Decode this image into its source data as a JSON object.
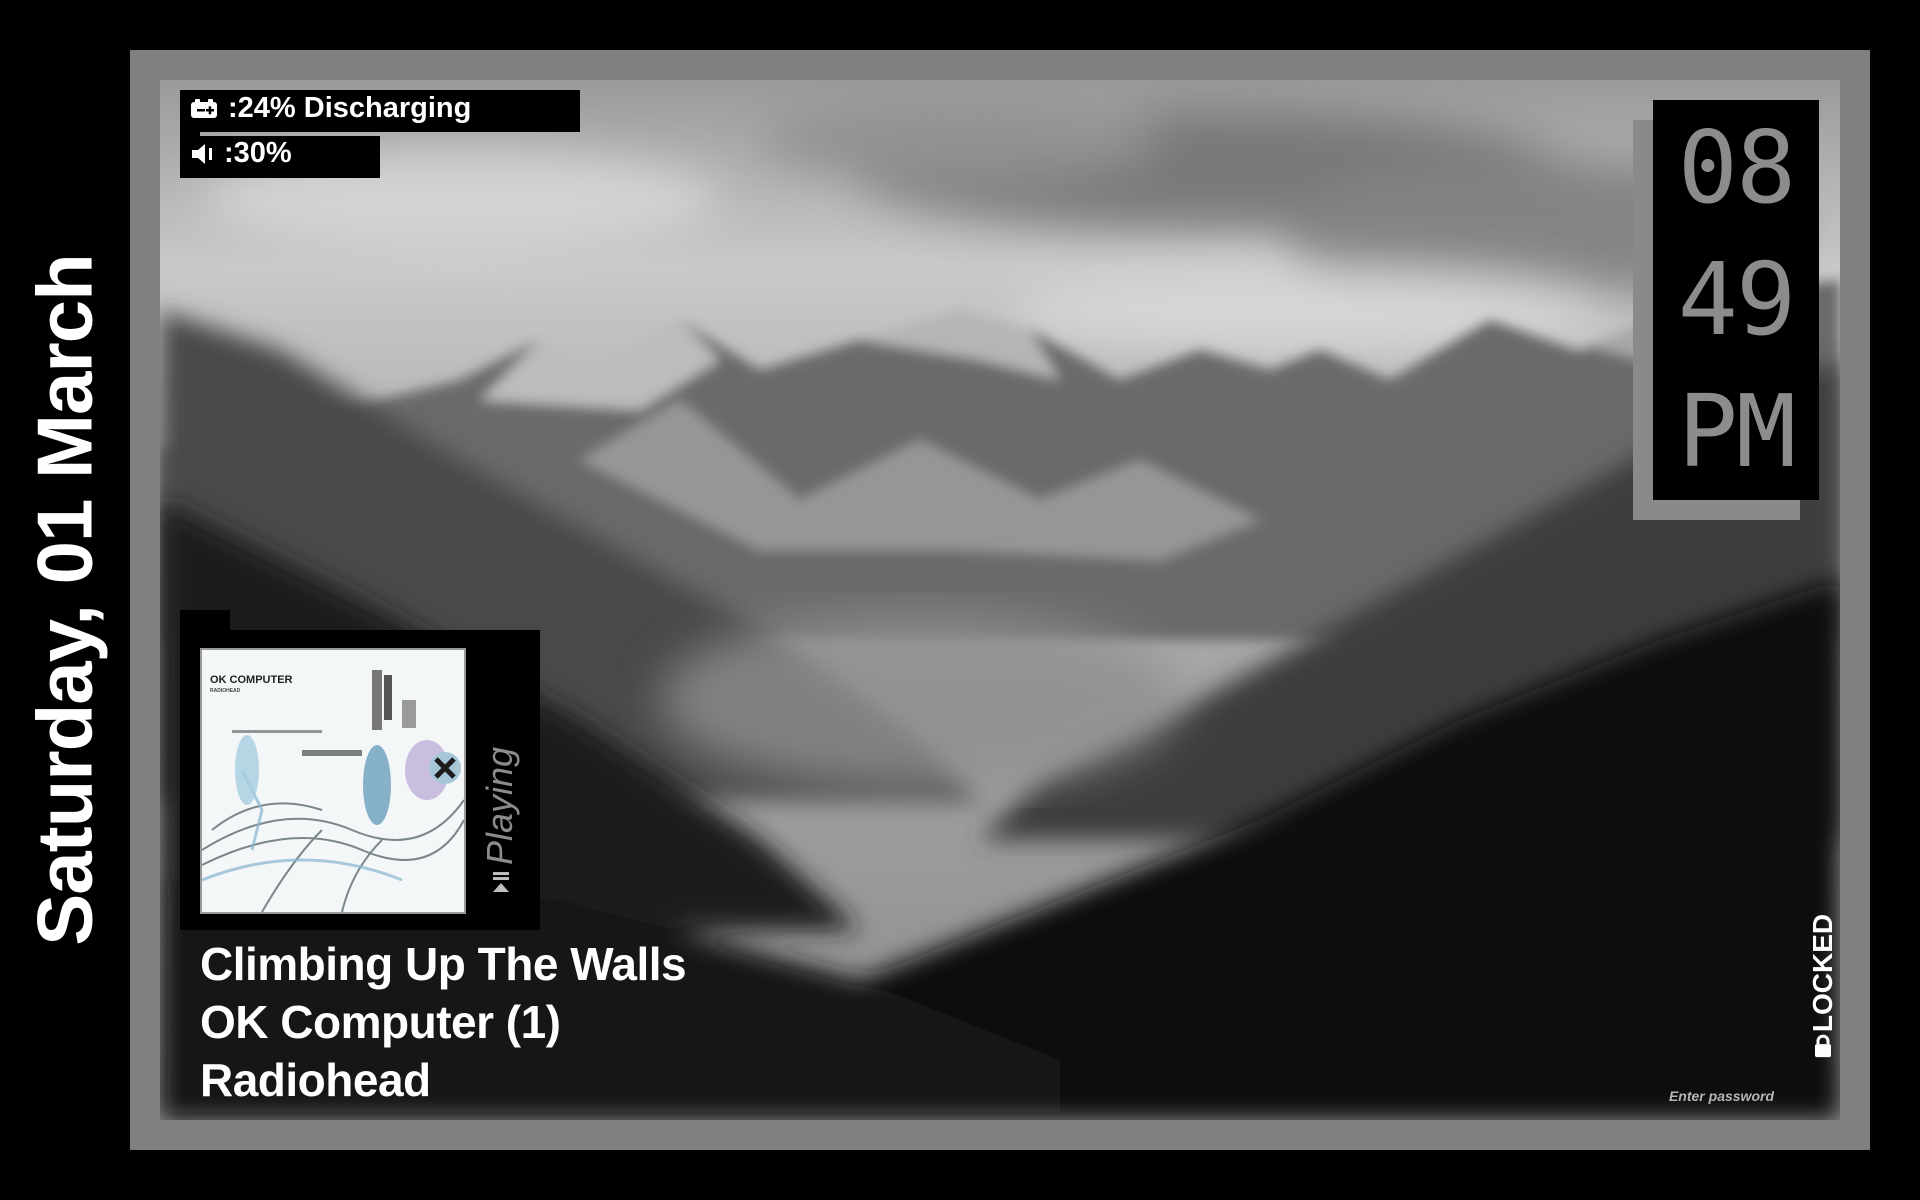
{
  "date": {
    "text": "Saturday, 01 March"
  },
  "status": {
    "battery_icon": "battery-icon",
    "battery_text": ":24% Discharging",
    "volume_icon": "volume-icon",
    "volume_text": ":30%"
  },
  "clock": {
    "hour": "08",
    "minute": "49",
    "period": "PM"
  },
  "media": {
    "album_cover_title": "OK COMPUTER",
    "album_cover_artist": "RADIOHEAD",
    "state_icon": "play-pause-icon",
    "state_label": "Playing",
    "track": "Climbing Up The Walls",
    "album": "OK Computer (1)",
    "artist": "Radiohead"
  },
  "lock": {
    "icon": "lock-icon",
    "label": "LOCKED"
  },
  "password": {
    "placeholder": "Enter password",
    "value": ""
  },
  "colors": {
    "background": "#000000",
    "frame": "#808080",
    "text_primary": "#ffffff",
    "text_muted": "#8c8c8c"
  }
}
